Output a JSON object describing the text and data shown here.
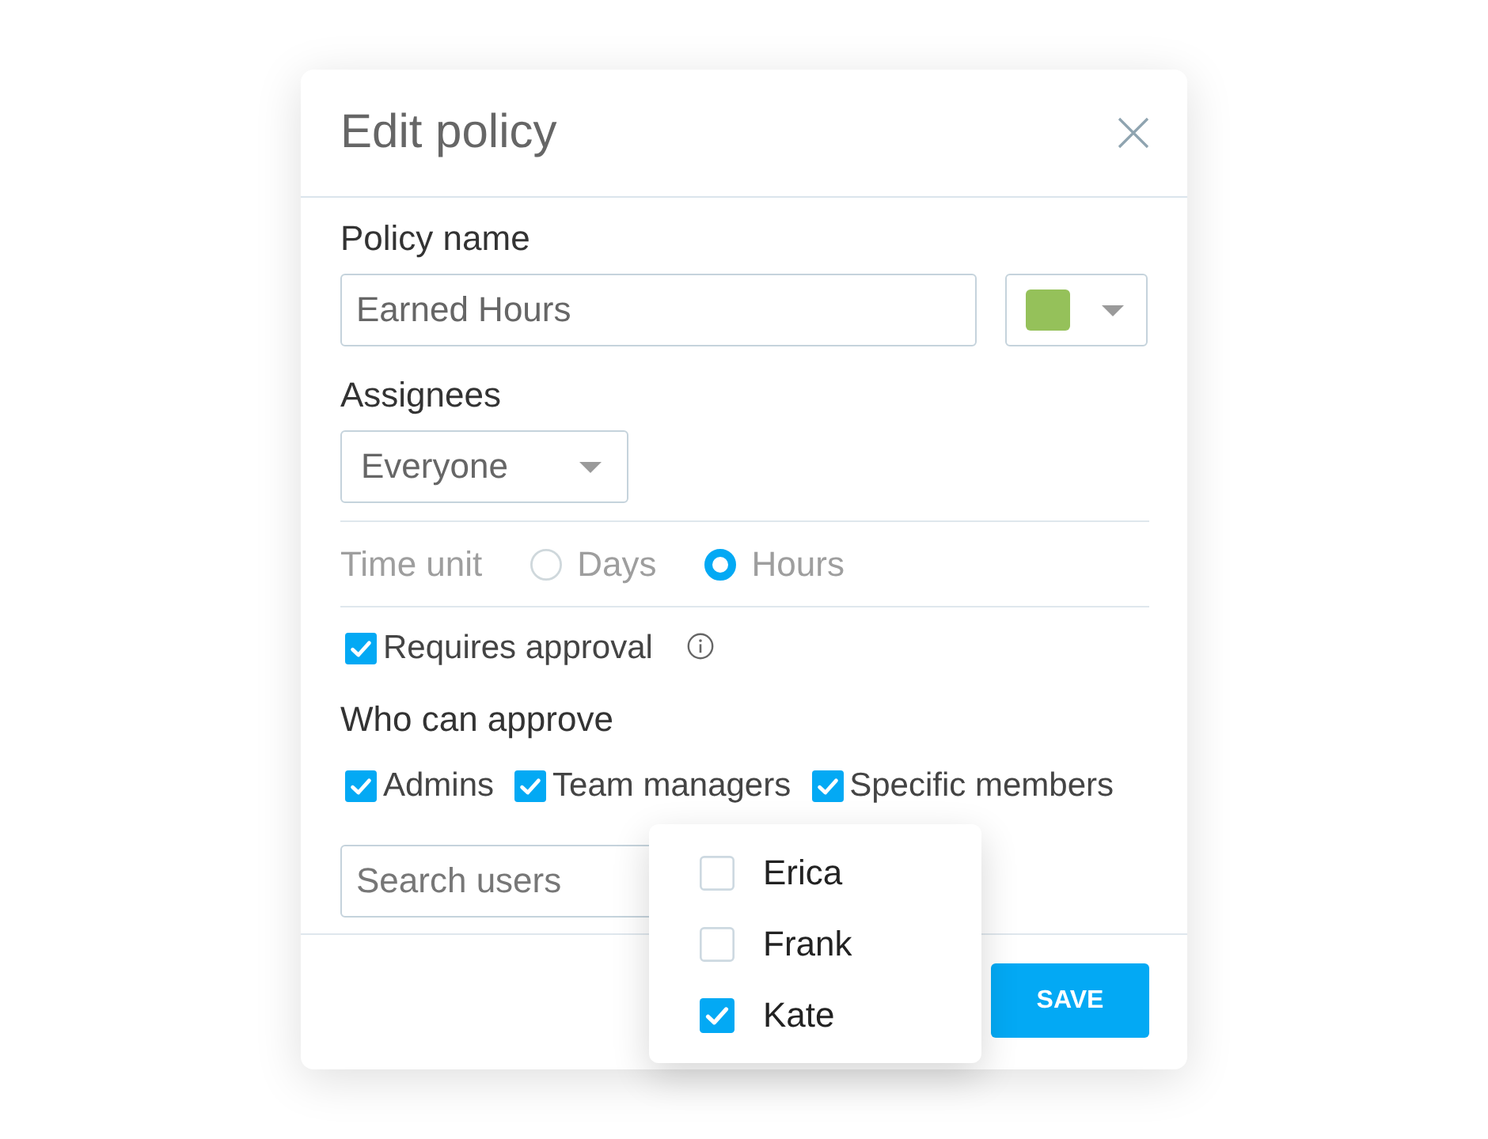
{
  "dialog": {
    "title": "Edit policy"
  },
  "policy_name": {
    "label": "Policy name",
    "value": "Earned Hours",
    "color": "#95c15a"
  },
  "assignees": {
    "label": "Assignees",
    "value": "Everyone"
  },
  "time_unit": {
    "label": "Time unit",
    "disabled": true,
    "options": [
      {
        "label": "Days",
        "selected": false
      },
      {
        "label": "Hours",
        "selected": true
      }
    ]
  },
  "requires_approval": {
    "label": "Requires approval",
    "checked": true
  },
  "approvers": {
    "label": "Who can approve",
    "options": [
      {
        "label": "Admins",
        "checked": true
      },
      {
        "label": "Team managers",
        "checked": true
      },
      {
        "label": "Specific members",
        "checked": true
      }
    ]
  },
  "search": {
    "placeholder": "Search users"
  },
  "user_menu": {
    "items": [
      {
        "label": "Erica",
        "checked": false
      },
      {
        "label": "Frank",
        "checked": false
      },
      {
        "label": "Kate",
        "checked": true
      }
    ]
  },
  "footer": {
    "buttons": [
      "SAVE"
    ]
  }
}
